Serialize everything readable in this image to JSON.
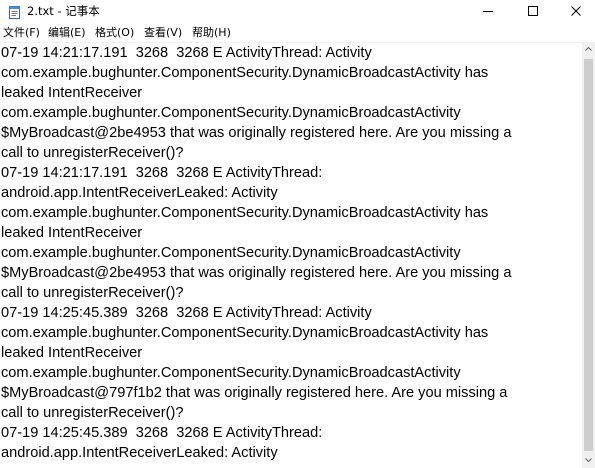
{
  "window": {
    "title": "2.txt - 记事本",
    "app_icon": "notepad-icon",
    "controls": {
      "minimize_icon": "minimize-icon",
      "maximize_icon": "maximize-icon",
      "close_icon": "close-icon"
    }
  },
  "menu": {
    "items": [
      {
        "label": "文件(F)"
      },
      {
        "label": "编辑(E)"
      },
      {
        "label": "格式(O)"
      },
      {
        "label": "查看(V)"
      },
      {
        "label": "帮助(H)"
      }
    ]
  },
  "editor": {
    "lines": [
      "07-19 14:21:17.191  3268  3268 E ActivityThread: Activity",
      "com.example.bughunter.ComponentSecurity.DynamicBroadcastActivity has",
      "leaked IntentReceiver",
      "com.example.bughunter.ComponentSecurity.DynamicBroadcastActivity",
      "$MyBroadcast@2be4953 that was originally registered here. Are you missing a",
      "call to unregisterReceiver()?",
      "07-19 14:21:17.191  3268  3268 E ActivityThread:",
      "android.app.IntentReceiverLeaked: Activity",
      "com.example.bughunter.ComponentSecurity.DynamicBroadcastActivity has",
      "leaked IntentReceiver",
      "com.example.bughunter.ComponentSecurity.DynamicBroadcastActivity",
      "$MyBroadcast@2be4953 that was originally registered here. Are you missing a",
      "call to unregisterReceiver()?",
      "07-19 14:25:45.389  3268  3268 E ActivityThread: Activity",
      "com.example.bughunter.ComponentSecurity.DynamicBroadcastActivity has",
      "leaked IntentReceiver",
      "com.example.bughunter.ComponentSecurity.DynamicBroadcastActivity",
      "$MyBroadcast@797f1b2 that was originally registered here. Are you missing a",
      "call to unregisterReceiver()?",
      "07-19 14:25:45.389  3268  3268 E ActivityThread:",
      "android.app.IntentReceiverLeaked: Activity"
    ]
  },
  "scrollbar": {
    "up_icon": "scroll-up-arrow-icon",
    "down_icon": "scroll-down-arrow-icon"
  }
}
